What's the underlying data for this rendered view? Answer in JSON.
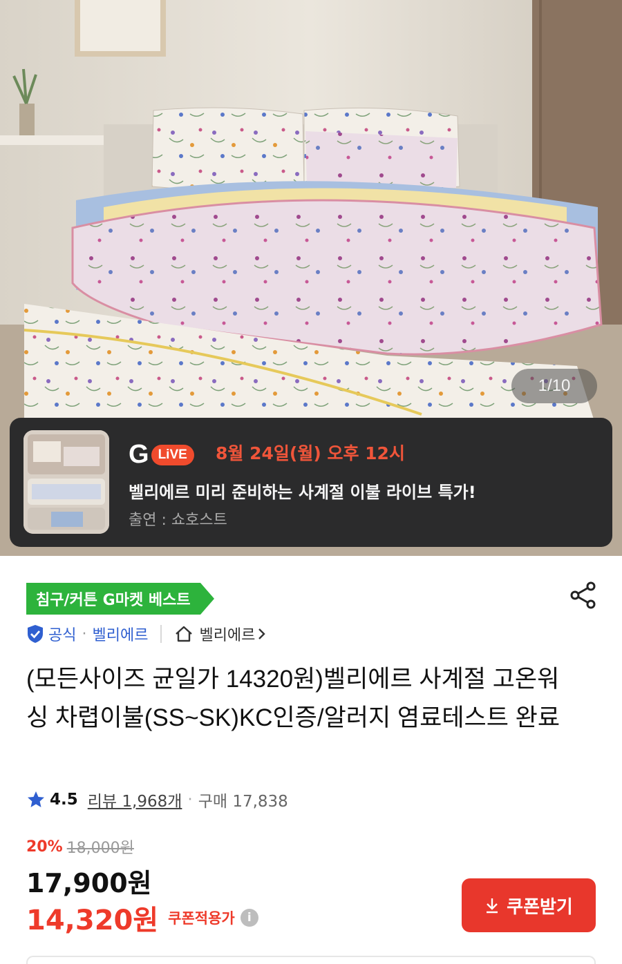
{
  "hero": {
    "image_alt": "floral bedding comforter on bed",
    "counter": "1/10"
  },
  "live": {
    "logo_g": "G",
    "logo_live": "LiVE",
    "date": "8월 24일(월) 오후 12시",
    "title": "벨리에르 미리 준비하는 사계절 이불 라이브 특가!",
    "cast": "출연 : 쇼호스트"
  },
  "product": {
    "badge": "침구/커튼 G마켓 베스트",
    "official_label": "공식",
    "brand": "벨리에르",
    "store_name": "벨리에르",
    "title": "(모든사이즈 균일가 14320원)벨리에르 사계절 고온워싱 차렵이불(SS~SK)KC인증/알러지 염료테스트 완료",
    "rating": "4.5",
    "review_label": "리뷰 1,968개",
    "purchase_label": "구매 17,838",
    "discount_pct": "20%",
    "original_price": "18,000원",
    "price": "17,900원",
    "coupon_price": "14,320원",
    "coupon_applied_label": "쿠폰적용가",
    "coupon_button": "쿠폰받기"
  },
  "colors": {
    "accent_red": "#e8372c",
    "badge_green": "#2db33c",
    "link_blue": "#2f5fd0"
  },
  "icons": {
    "share": "share-icon",
    "shield": "shield-check-icon",
    "home": "home-icon",
    "star": "star-icon",
    "info": "info-icon",
    "download": "download-icon"
  }
}
